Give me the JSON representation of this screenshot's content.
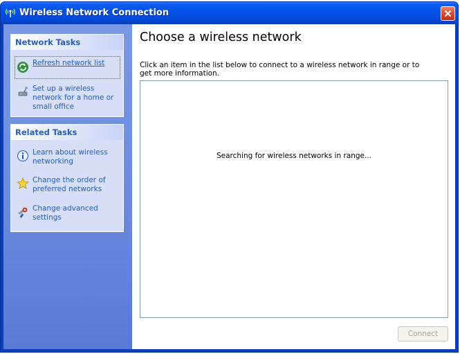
{
  "window": {
    "title": "Wireless Network Connection",
    "close_icon": "close-icon"
  },
  "sidebar": {
    "network_tasks": {
      "header": "Network Tasks",
      "items": [
        {
          "label": "Refresh network list",
          "icon": "refresh-icon",
          "focused": true
        },
        {
          "label": "Set up a wireless network for a home or small office",
          "icon": "wireless-setup-icon"
        }
      ]
    },
    "related_tasks": {
      "header": "Related Tasks",
      "items": [
        {
          "label": "Learn about wireless networking",
          "icon": "info-icon"
        },
        {
          "label": "Change the order of preferred networks",
          "icon": "star-icon"
        },
        {
          "label": "Change advanced settings",
          "icon": "settings-wrench-icon"
        }
      ]
    }
  },
  "main": {
    "heading": "Choose a wireless network",
    "instruction": "Click an item in the list below to connect to a wireless network in range or to get more information.",
    "list_status": "Searching for wireless networks in range...",
    "connect_button": "Connect",
    "connect_enabled": false
  },
  "colors": {
    "title_bar": "#0550e8",
    "sidebar": "#6f8ee0",
    "link": "#215dc6",
    "close_button": "#d2412a"
  }
}
